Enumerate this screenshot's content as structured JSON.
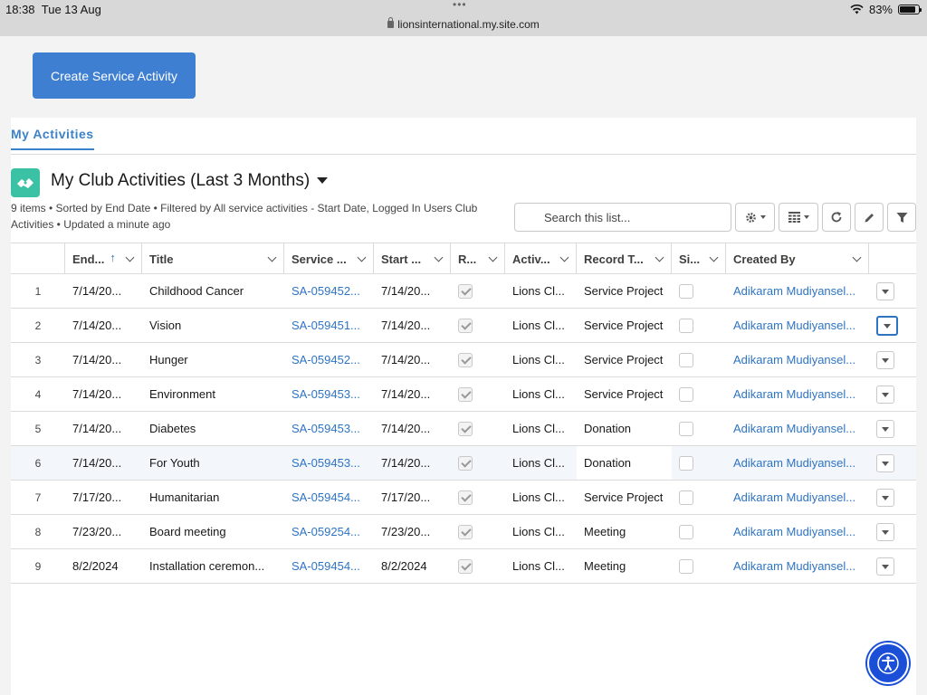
{
  "status": {
    "time": "18:38",
    "date": "Tue 13 Aug",
    "battery": "83%",
    "battery_level": 0.83,
    "url": "lionsinternational.my.site.com"
  },
  "create_button_label": "Create Service Activity",
  "tab_label": "My Activities",
  "list": {
    "title": "My Club Activities (Last 3 Months)",
    "meta": "9 items • Sorted by End Date • Filtered by All service activities - Start Date, Logged In Users Club Activities • Updated a minute ago",
    "search_placeholder": "Search this list..."
  },
  "columns": [
    "End...",
    "Title",
    "Service ...",
    "Start ...",
    "R...",
    "Activ...",
    "Record T...",
    "Si...",
    "Created By"
  ],
  "rows": [
    {
      "n": "1",
      "end": "7/14/20...",
      "title": "Childhood Cancer",
      "service": "SA-059452...",
      "start": "7/14/20...",
      "activity": "Lions Cl...",
      "record": "Service Project",
      "created": "Adikaram Mudiyansel..."
    },
    {
      "n": "2",
      "end": "7/14/20...",
      "title": "Vision",
      "service": "SA-059451...",
      "start": "7/14/20...",
      "activity": "Lions Cl...",
      "record": "Service Project",
      "created": "Adikaram Mudiyansel..."
    },
    {
      "n": "3",
      "end": "7/14/20...",
      "title": "Hunger",
      "service": "SA-059452...",
      "start": "7/14/20...",
      "activity": "Lions Cl...",
      "record": "Service Project",
      "created": "Adikaram Mudiyansel..."
    },
    {
      "n": "4",
      "end": "7/14/20...",
      "title": "Environment",
      "service": "SA-059453...",
      "start": "7/14/20...",
      "activity": "Lions Cl...",
      "record": "Service Project",
      "created": "Adikaram Mudiyansel..."
    },
    {
      "n": "5",
      "end": "7/14/20...",
      "title": "Diabetes",
      "service": "SA-059453...",
      "start": "7/14/20...",
      "activity": "Lions Cl...",
      "record": "Donation",
      "created": "Adikaram Mudiyansel..."
    },
    {
      "n": "6",
      "end": "7/14/20...",
      "title": "For Youth",
      "service": "SA-059453...",
      "start": "7/14/20...",
      "activity": "Lions Cl...",
      "record": "Donation",
      "created": "Adikaram Mudiyansel..."
    },
    {
      "n": "7",
      "end": "7/17/20...",
      "title": "Humanitarian",
      "service": "SA-059454...",
      "start": "7/17/20...",
      "activity": "Lions Cl...",
      "record": "Service Project",
      "created": "Adikaram Mudiyansel..."
    },
    {
      "n": "8",
      "end": "7/23/20...",
      "title": "Board meeting",
      "service": "SA-059254...",
      "start": "7/23/20...",
      "activity": "Lions Cl...",
      "record": "Meeting",
      "created": "Adikaram Mudiyansel..."
    },
    {
      "n": "9",
      "end": "8/2/2024",
      "title": "Installation ceremon...",
      "service": "SA-059454...",
      "start": "8/2/2024",
      "activity": "Lions Cl...",
      "record": "Meeting",
      "created": "Adikaram Mudiyansel..."
    }
  ],
  "colors": {
    "accent": "#3f7fd2",
    "link": "#2e74c5",
    "list_icon": "#3bc1a4"
  },
  "icons": [
    "handshake-icon",
    "search-icon",
    "gear-icon",
    "table-icon",
    "refresh-icon",
    "pencil-icon",
    "filter-icon",
    "accessibility-icon"
  ]
}
